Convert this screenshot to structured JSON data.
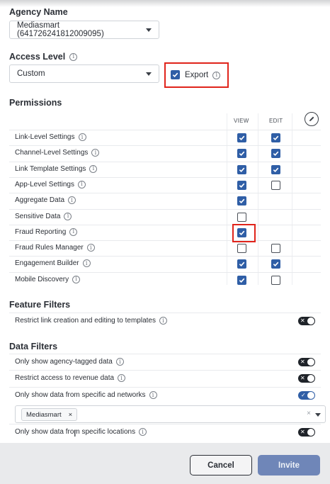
{
  "agency": {
    "title": "Agency Name",
    "selected": "Mediasmart (641726241812009095)"
  },
  "access": {
    "title": "Access Level",
    "selected": "Custom",
    "export_label": "Export"
  },
  "permissions": {
    "title": "Permissions",
    "col_view": "VIEW",
    "col_edit": "EDIT",
    "rows": [
      {
        "label": "Link-Level Settings",
        "view": true,
        "edit": true
      },
      {
        "label": "Channel-Level Settings",
        "view": true,
        "edit": true
      },
      {
        "label": "Link Template Settings",
        "view": true,
        "edit": true
      },
      {
        "label": "App-Level Settings",
        "view": true,
        "edit": false
      },
      {
        "label": "Aggregate Data",
        "view": true,
        "edit": null
      },
      {
        "label": "Sensitive Data",
        "view": false,
        "edit": null
      },
      {
        "label": "Fraud Reporting",
        "view": true,
        "edit": null
      },
      {
        "label": "Fraud Rules Manager",
        "view": false,
        "edit": false
      },
      {
        "label": "Engagement Builder",
        "view": true,
        "edit": true
      },
      {
        "label": "Mobile Discovery",
        "view": true,
        "edit": false
      }
    ]
  },
  "feature_filters": {
    "title": "Feature Filters",
    "items": [
      {
        "label": "Restrict link creation and editing to templates",
        "on": false
      }
    ]
  },
  "data_filters": {
    "title": "Data Filters",
    "items": [
      {
        "label": "Only show agency-tagged data",
        "on": false
      },
      {
        "label": "Restrict access to revenue data",
        "on": false
      },
      {
        "label": "Only show data from specific ad networks",
        "on": true
      },
      {
        "label": "Only show data from specific locations",
        "on": false
      }
    ],
    "ad_network_tag": "Mediasmart",
    "tag_remove": "×",
    "clear": "×"
  },
  "footer": {
    "cancel": "Cancel",
    "invite": "Invite"
  },
  "colors": {
    "accent": "#2f5ea6",
    "highlight": "#e0241b",
    "invite_button": "#6f86b8"
  }
}
